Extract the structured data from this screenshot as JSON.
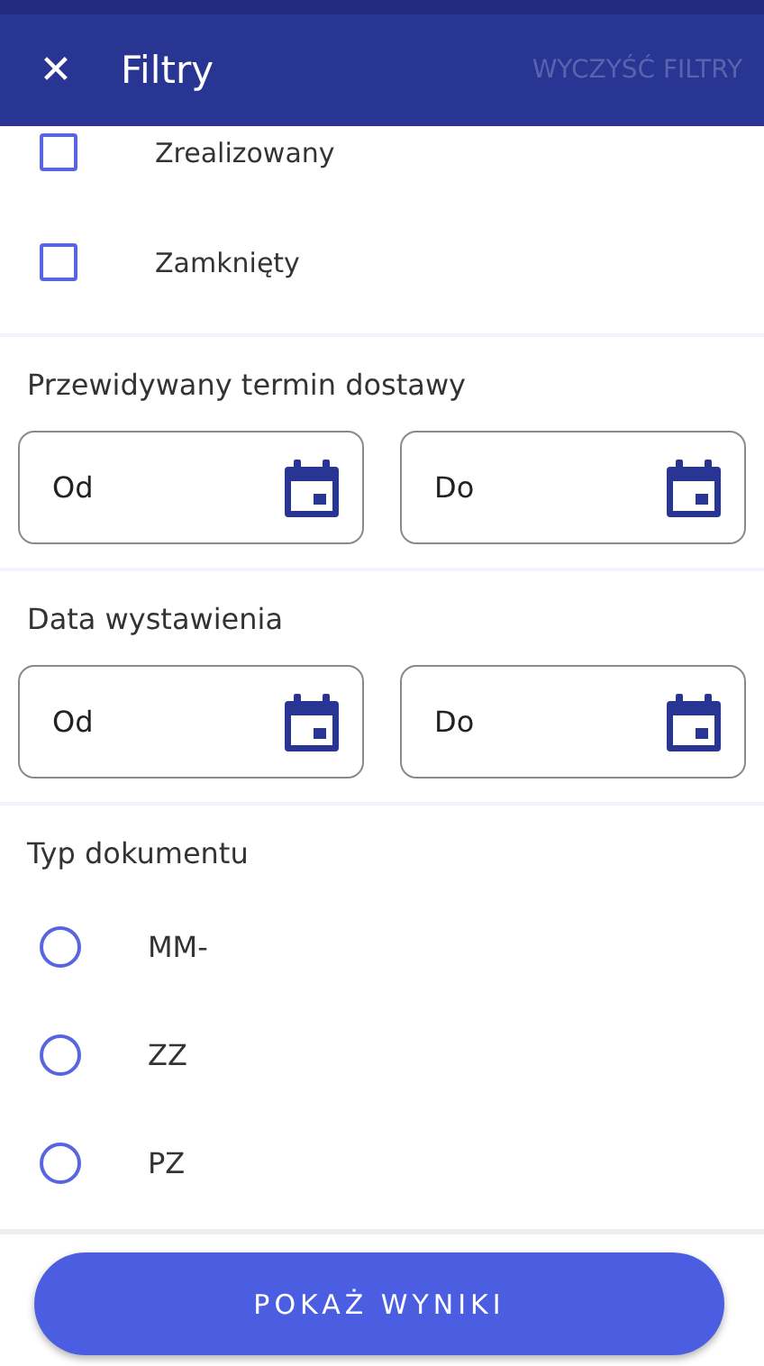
{
  "header": {
    "close_icon": "✕",
    "title": "Filtry",
    "clear_button": {
      "label": "WYCZYŚĆ FILTRY",
      "disabled": true
    }
  },
  "status_options": [
    {
      "label": "Zrealizowany",
      "checked": false
    },
    {
      "label": "Zamknięty",
      "checked": false
    }
  ],
  "date_sections": [
    {
      "title": "Przewidywany termin dostawy",
      "fields": [
        {
          "placeholder": "Od"
        },
        {
          "placeholder": "Do"
        }
      ]
    },
    {
      "title": "Data wystawienia",
      "fields": [
        {
          "placeholder": "Od"
        },
        {
          "placeholder": "Do"
        }
      ]
    }
  ],
  "document_type": {
    "title": "Typ dokumentu",
    "options": [
      {
        "label": "MM-",
        "selected": false
      },
      {
        "label": "ZZ",
        "selected": false
      },
      {
        "label": "PZ",
        "selected": false
      }
    ]
  },
  "submit_button": "POKAŻ WYNIKI"
}
